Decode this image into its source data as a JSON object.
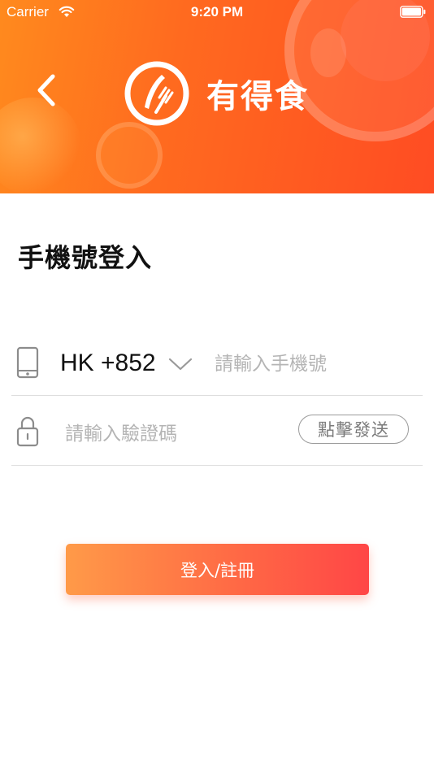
{
  "status_bar": {
    "carrier": "Carrier",
    "time": "9:20 PM"
  },
  "header": {
    "brand_name": "有得食",
    "brand_color": "#ff5a22"
  },
  "page_title": "手機號登入",
  "phone_row": {
    "country_code": "HK +852",
    "placeholder": "請輸入手機號"
  },
  "code_row": {
    "placeholder": "請輸入驗證碼",
    "send_label": "點擊發送"
  },
  "login_button_label": "登入/註冊",
  "colors": {
    "accent_start": "#ff9a48",
    "accent_end": "#ff4646",
    "placeholder": "#b4b4b4"
  },
  "icons": [
    "wifi-icon",
    "battery-icon",
    "back-chevron-icon",
    "brand-logo-icon",
    "phone-icon",
    "chevron-down-icon",
    "lock-icon"
  ]
}
